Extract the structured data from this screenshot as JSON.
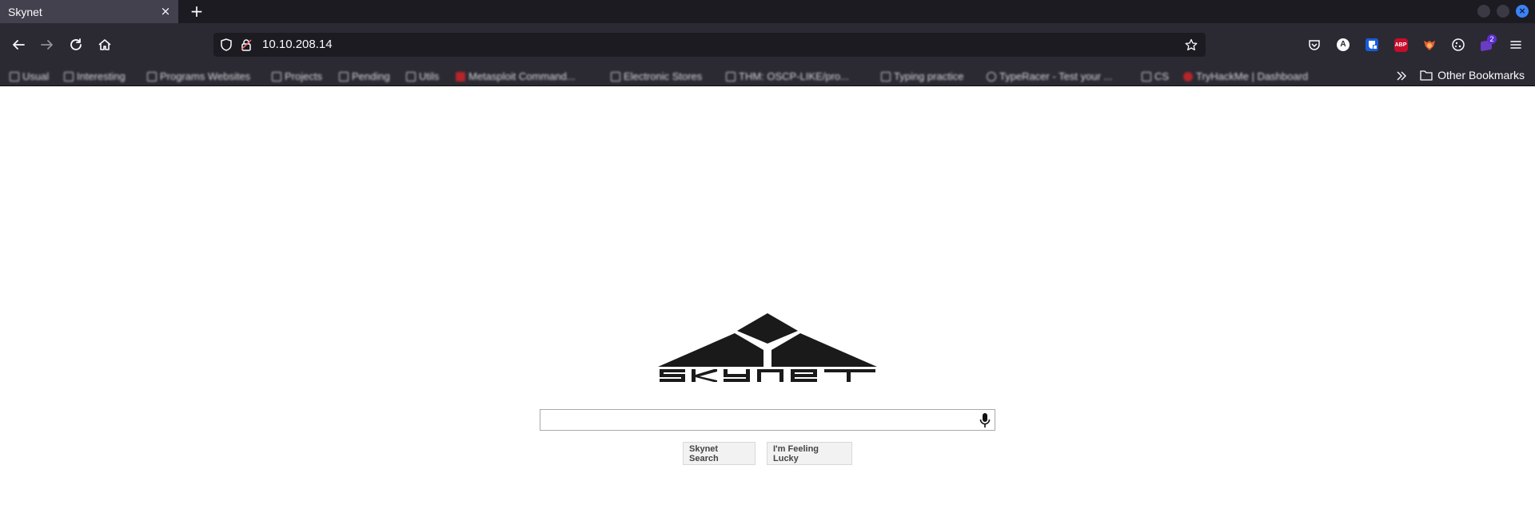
{
  "browser": {
    "tab": {
      "title": "Skynet",
      "close_glyph": "×"
    },
    "new_tab_glyph": "+",
    "url": "10.10.208.14",
    "toolbar_icons": [
      "back-icon",
      "forward-icon",
      "reload-icon",
      "home-icon"
    ],
    "extensions": [
      "pocket-icon",
      "extension-a-icon",
      "bitwarden-icon",
      "adblock-plus-icon",
      "foxyproxy-icon",
      "cookie-icon",
      "wappalyzer-icon",
      "menu-icon"
    ],
    "extension_labels": {
      "abp": "ABP",
      "a": "A",
      "badge": "2"
    },
    "bookmarks": [
      "Usual",
      "Interesting",
      "Programs Websites",
      "Projects",
      "Pending",
      "Utils",
      "Metasploit Command...",
      "Electronic Stores",
      "THM: OSCP-LIKE/pro...",
      "Typing practice",
      "TypeRacer - Test your ...",
      "CS",
      "TryHackMe | Dashboard"
    ],
    "other_bookmarks": "Other Bookmarks"
  },
  "page": {
    "logo_text": "SKYNET",
    "search": {
      "value": "",
      "placeholder": ""
    },
    "buttons": {
      "search": "Skynet Search",
      "lucky": "I'm Feeling Lucky"
    }
  },
  "colors": {
    "tabstrip_bg": "#1c1b22",
    "toolbar_bg": "#2b2a33",
    "active_tab_bg": "#42414d",
    "close_button": "#3b82f6",
    "logo": "#1a1a1a"
  }
}
